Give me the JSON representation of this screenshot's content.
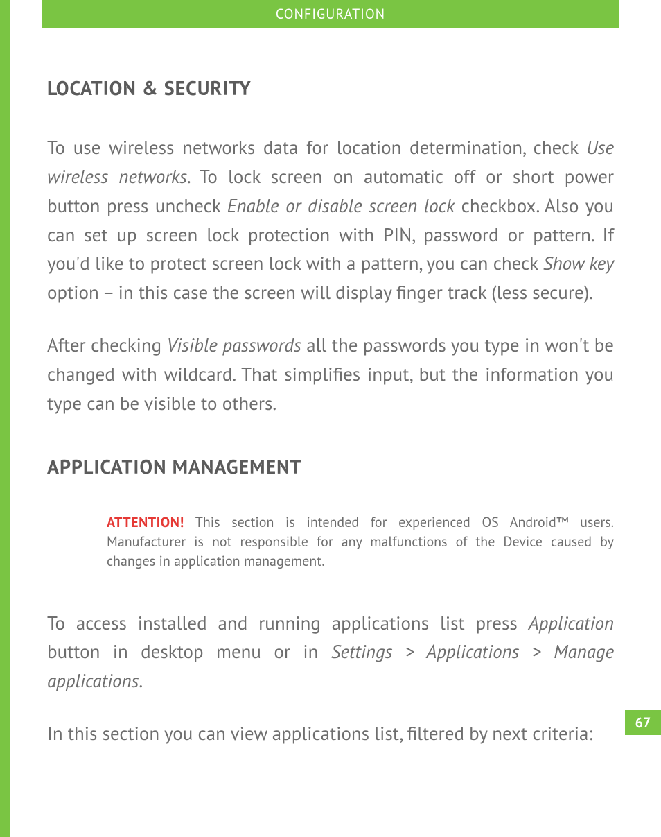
{
  "header": {
    "title": "CONFIGURATION"
  },
  "page": {
    "number": "67"
  },
  "sections": {
    "locsec": {
      "heading": "LOCATION & SECURITY",
      "p1_a": "To use wireless networks data for location determination, check ",
      "p1_i1": "Use wireless networks",
      "p1_b": ". To lock screen on automatic off or short power button press uncheck ",
      "p1_i2": "Enable or disable screen lock",
      "p1_c": " checkbox. Also you can set up screen lock protection with PIN, password or pattern. If you'd like to protect screen lock with a pattern, you can check ",
      "p1_i3": "Show key",
      "p1_d": " option – in this case the screen will display finger track (less secure).",
      "p2_a": "After checking ",
      "p2_i1": "Visible passwords",
      "p2_b": " all the passwords you type in won't be changed with wildcard. That simplifies input, but the information you type can be visible to others."
    },
    "appmgmt": {
      "heading": "APPLICATION MANAGEMENT",
      "attention_label": "ATTENTION!",
      "attention_text": " This section is intended for experienced OS Android™ users. Manufacturer is not responsible for any malfunctions of the Device caused by changes in application management.",
      "p1_a": "To access installed and running applications list press ",
      "p1_i1": "Application",
      "p1_b": " button in desktop menu or in ",
      "p1_i2": "Settings > Applications > Manage applications",
      "p1_c": ".",
      "p2": "In this section you can view applications list, filtered by next criteria:"
    }
  }
}
